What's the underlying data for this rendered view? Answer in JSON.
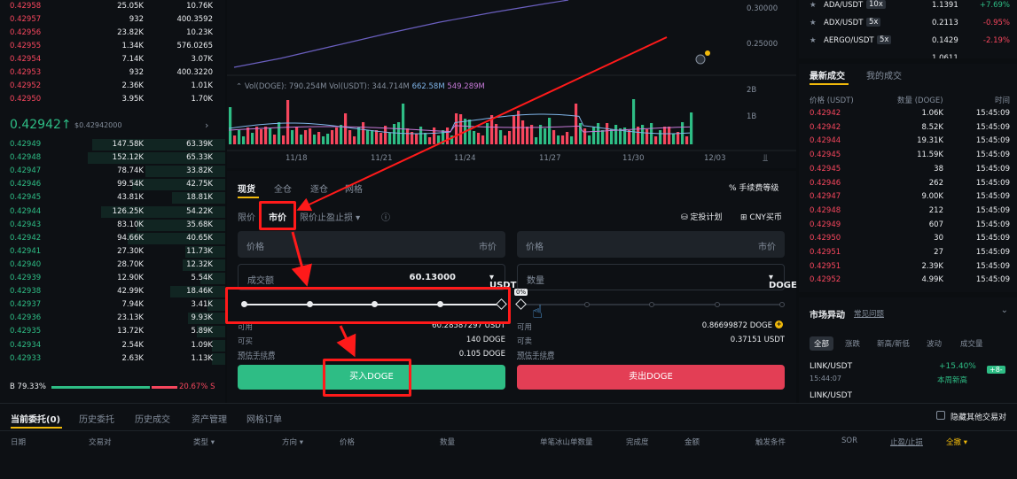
{
  "orderbook": {
    "asks": [
      {
        "price": "0.42958",
        "amount": "25.05K",
        "total": "10.76K"
      },
      {
        "price": "0.42957",
        "amount": "932",
        "total": "400.3592"
      },
      {
        "price": "0.42956",
        "amount": "23.82K",
        "total": "10.23K"
      },
      {
        "price": "0.42955",
        "amount": "1.34K",
        "total": "576.0265"
      },
      {
        "price": "0.42954",
        "amount": "7.14K",
        "total": "3.07K"
      },
      {
        "price": "0.42953",
        "amount": "932",
        "total": "400.3220"
      },
      {
        "price": "0.42952",
        "amount": "2.36K",
        "total": "1.01K"
      },
      {
        "price": "0.42950",
        "amount": "3.95K",
        "total": "1.70K"
      }
    ],
    "last_price": "0.42942",
    "last_price_arrow": "↑",
    "last_price_usd": "$0.42942000",
    "bids": [
      {
        "price": "0.42949",
        "amount": "147.58K",
        "total": "63.39K"
      },
      {
        "price": "0.42948",
        "amount": "152.12K",
        "total": "65.33K"
      },
      {
        "price": "0.42947",
        "amount": "78.74K",
        "total": "33.82K"
      },
      {
        "price": "0.42946",
        "amount": "99.54K",
        "total": "42.75K"
      },
      {
        "price": "0.42945",
        "amount": "43.81K",
        "total": "18.81K"
      },
      {
        "price": "0.42944",
        "amount": "126.25K",
        "total": "54.22K"
      },
      {
        "price": "0.42943",
        "amount": "83.10K",
        "total": "35.68K"
      },
      {
        "price": "0.42942",
        "amount": "94.66K",
        "total": "40.65K"
      },
      {
        "price": "0.42941",
        "amount": "27.30K",
        "total": "11.73K"
      },
      {
        "price": "0.42940",
        "amount": "28.70K",
        "total": "12.32K"
      },
      {
        "price": "0.42939",
        "amount": "12.90K",
        "total": "5.54K"
      },
      {
        "price": "0.42938",
        "amount": "42.99K",
        "total": "18.46K"
      },
      {
        "price": "0.42937",
        "amount": "7.94K",
        "total": "3.41K"
      },
      {
        "price": "0.42936",
        "amount": "23.13K",
        "total": "9.93K"
      },
      {
        "price": "0.42935",
        "amount": "13.72K",
        "total": "5.89K"
      },
      {
        "price": "0.42934",
        "amount": "2.54K",
        "total": "1.09K"
      },
      {
        "price": "0.42933",
        "amount": "2.63K",
        "total": "1.13K"
      }
    ],
    "buy_ratio": "B 79.33%",
    "sell_ratio": "20.67% S",
    "buy_fraction": 0.7933
  },
  "chart": {
    "price_ticks": [
      "0.30000",
      "0.25000"
    ],
    "vol_label": "Vol(DOGE): 790.254M  Vol(USDT): 344.714M",
    "vol_ma1": "662.58M",
    "vol_ma2": "549.289M",
    "vol_ticks": [
      "2B",
      "1B"
    ],
    "dates": [
      "11/18",
      "11/21",
      "11/24",
      "11/27",
      "11/30",
      "12/03"
    ]
  },
  "trade": {
    "tabs": [
      "现货",
      "全仓",
      "逐仓",
      "网格"
    ],
    "fee_label": "手续费等级",
    "order_types": [
      "限价",
      "市价",
      "限价止盈止损"
    ],
    "plan_label": "定投计划",
    "currency_label": "CNY买币",
    "buy": {
      "price_label": "价格",
      "price_placeholder": "市价",
      "amount_label": "成交额",
      "amount_value": "60.13000",
      "amount_unit": "USDT",
      "available_label": "可用",
      "available_value": "60.28587297 USDT",
      "can_buy_label": "可买",
      "can_buy_value": "140 DOGE",
      "fee_label": "预估手续费",
      "fee_value": "0.105 DOGE",
      "button": "买入DOGE"
    },
    "sell": {
      "price_label": "价格",
      "price_placeholder": "市价",
      "qty_label": "数量",
      "qty_unit": "DOGE",
      "slider_tip": "0%",
      "available_label": "可用",
      "available_value": "0.86699872 DOGE",
      "can_sell_label": "可卖",
      "can_sell_value": "0.37151 USDT",
      "fee_label": "预估手续费",
      "button": "卖出DOGE"
    }
  },
  "right": {
    "tickers": [
      {
        "pair": "ADA/USDT",
        "lev": "10x",
        "price": "1.1391",
        "change": "+7.69%",
        "up": true
      },
      {
        "pair": "ADX/USDT",
        "lev": "5x",
        "price": "0.2113",
        "change": "-0.95%",
        "up": false
      },
      {
        "pair": "AERGO/USDT",
        "lev": "5x",
        "price": "0.1429",
        "change": "-2.19%",
        "up": false
      },
      {
        "pair": "",
        "lev": "",
        "price": "1.0611",
        "change": "",
        "up": false
      }
    ],
    "trades_tabs": [
      "最新成交",
      "我的成交"
    ],
    "trades_headers": [
      "价格 (USDT)",
      "数量 (DOGE)",
      "时间"
    ],
    "trades": [
      {
        "p": "0.42942",
        "a": "1.06K",
        "t": "15:45:09"
      },
      {
        "p": "0.42942",
        "a": "8.52K",
        "t": "15:45:09"
      },
      {
        "p": "0.42944",
        "a": "19.31K",
        "t": "15:45:09"
      },
      {
        "p": "0.42945",
        "a": "11.59K",
        "t": "15:45:09"
      },
      {
        "p": "0.42945",
        "a": "38",
        "t": "15:45:09"
      },
      {
        "p": "0.42946",
        "a": "262",
        "t": "15:45:09"
      },
      {
        "p": "0.42947",
        "a": "9.00K",
        "t": "15:45:09"
      },
      {
        "p": "0.42948",
        "a": "212",
        "t": "15:45:09"
      },
      {
        "p": "0.42949",
        "a": "607",
        "t": "15:45:09"
      },
      {
        "p": "0.42950",
        "a": "30",
        "t": "15:45:09"
      },
      {
        "p": "0.42951",
        "a": "27",
        "t": "15:45:09"
      },
      {
        "p": "0.42951",
        "a": "2.39K",
        "t": "15:45:09"
      },
      {
        "p": "0.42952",
        "a": "4.99K",
        "t": "15:45:09"
      }
    ],
    "market_title": "市场异动",
    "market_link": "常见问题",
    "market_filters": [
      "全部",
      "涨跌",
      "新高/新低",
      "波动",
      "成交量"
    ],
    "market_item": {
      "pair": "LINK/USDT",
      "time": "15:44:07",
      "change": "+15.40%",
      "note": "本周新高",
      "badge": "+8-"
    },
    "market_item2": "LINK/USDT"
  },
  "bottom": {
    "tabs": [
      "当前委托(0)",
      "历史委托",
      "历史成交",
      "资产管理",
      "网格订单"
    ],
    "hide_label": "隐藏其他交易对",
    "columns": [
      "日期",
      "交易对",
      "类型",
      "方向",
      "价格",
      "数量",
      "单笔冰山单数量",
      "完成度",
      "金额",
      "触发条件",
      "SOR",
      "止盈/止损",
      "全撤"
    ]
  },
  "colors": {
    "buy": "#2ebd85",
    "sell": "#f6465d",
    "annotation": "#ff1a1a",
    "accent": "#f0b90b"
  }
}
